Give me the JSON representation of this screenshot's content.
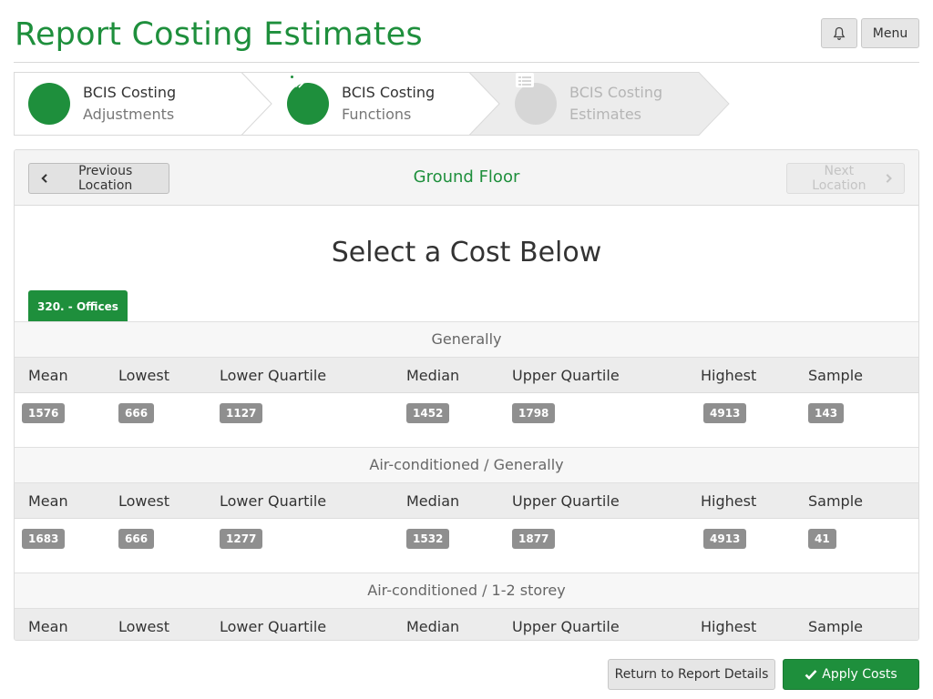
{
  "header": {
    "title": "Report Costing Estimates",
    "menu_label": "Menu"
  },
  "wizard": {
    "steps": [
      {
        "title": "BCIS Costing",
        "subtitle": "Adjustments",
        "icon": "pencil-icon",
        "state": "complete"
      },
      {
        "title": "BCIS Costing",
        "subtitle": "Functions",
        "icon": "tags-icon",
        "state": "complete"
      },
      {
        "title": "BCIS Costing",
        "subtitle": "Estimates",
        "icon": "list-icon",
        "state": "disabled"
      }
    ]
  },
  "location": {
    "prev_label": "Previous Location",
    "name": "Ground Floor",
    "next_label": "Next Location"
  },
  "select_title": "Select a Cost Below",
  "active_tab": "320. - Offices",
  "columns": [
    "Mean",
    "Lowest",
    "Lower Quartile",
    "Median",
    "Upper Quartile",
    "Highest",
    "Sample"
  ],
  "groups": [
    {
      "title": "Generally",
      "values": [
        "1576",
        "666",
        "1127",
        "1452",
        "1798",
        "4913",
        "143"
      ]
    },
    {
      "title": "Air-conditioned / Generally",
      "values": [
        "1683",
        "666",
        "1277",
        "1532",
        "1877",
        "4913",
        "41"
      ]
    },
    {
      "title": "Air-conditioned / 1-2 storey",
      "values": []
    }
  ],
  "footer": {
    "return_label": "Return to Report Details",
    "apply_label": "Apply Costs"
  },
  "colors": {
    "brand_green": "#1e8f3c",
    "badge_gray": "#8f8f8f",
    "disabled_gray": "#d0d0d0"
  }
}
